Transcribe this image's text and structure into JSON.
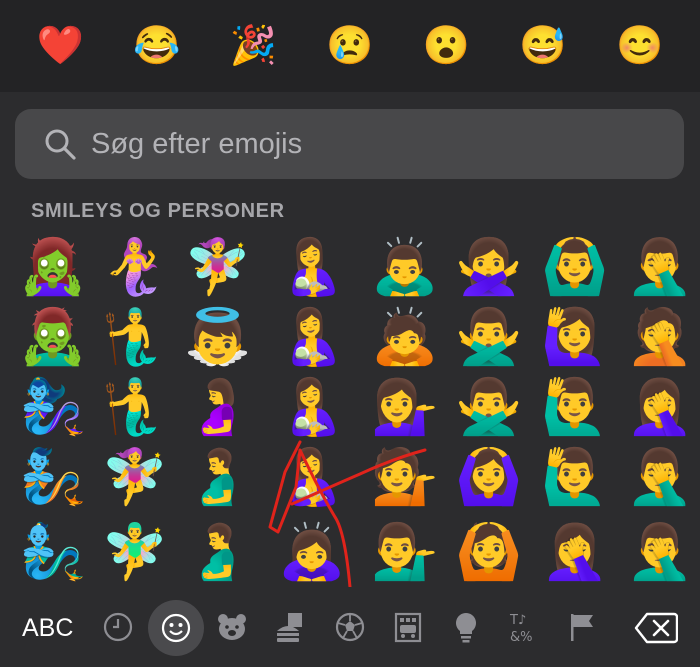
{
  "recents": {
    "emojis": [
      {
        "char": "❤️",
        "icon": "red-heart-icon"
      },
      {
        "char": "😂",
        "icon": "tears-of-joy-icon"
      },
      {
        "char": "🎉",
        "icon": "party-popper-icon"
      },
      {
        "char": "😢",
        "icon": "crying-face-icon"
      },
      {
        "char": "😮",
        "icon": "surprised-face-icon"
      },
      {
        "char": "😅",
        "icon": "sweat-smile-icon"
      },
      {
        "char": "😊",
        "icon": "smiling-face-icon"
      }
    ]
  },
  "search": {
    "placeholder": "Søg efter emojis"
  },
  "section": {
    "title": "SMILEYS OG PERSONER"
  },
  "emoji_grid": {
    "rows": [
      [
        "🧟‍♀️",
        "🧜‍♀️",
        "🧚‍♀️",
        "🤱",
        "🙇‍♂️",
        "🙅‍♀️",
        "🙆‍♂️",
        "🤦‍♂️"
      ],
      [
        "🧟‍♂️",
        "🧜‍♂️",
        "👼",
        "🤱",
        "🙇",
        "🙅‍♂️",
        "🙋‍♀️",
        "🤦"
      ],
      [
        "🧞‍♀️",
        "🧜‍♂️",
        "🤰",
        "🤱",
        "💁‍♀️",
        "🙅‍♂️",
        "🙋‍♂️",
        "🤦‍♀️"
      ],
      [
        "🧞",
        "🧚‍♀️",
        "🫃",
        "🤱",
        "💁",
        "🙆‍♀️",
        "🙋‍♂️",
        "🤦‍♂️"
      ],
      [
        "🧞‍♂️",
        "🧚‍♂️",
        "🫃",
        "🙇‍♀️",
        "💁‍♂️",
        "🙆",
        "🤦‍♀️",
        "🤦‍♂️"
      ]
    ]
  },
  "bottom_bar": {
    "abc_label": "ABC",
    "categories": [
      {
        "icon": "clock-icon",
        "active": false
      },
      {
        "icon": "smiley-icon",
        "active": true
      },
      {
        "icon": "bear-icon",
        "active": false
      },
      {
        "icon": "food-icon",
        "active": false
      },
      {
        "icon": "soccer-ball-icon",
        "active": false
      },
      {
        "icon": "building-icon",
        "active": false
      },
      {
        "icon": "lightbulb-icon",
        "active": false
      },
      {
        "icon": "symbols-icon",
        "active": false
      },
      {
        "icon": "flag-icon",
        "active": false
      }
    ],
    "symbols_label": "T♪ &%",
    "delete_icon": "backspace-icon"
  },
  "colors": {
    "panel_bg": "#2c2c2e",
    "recents_bg": "#232325",
    "search_bg": "#48484a",
    "scribble": "#e0231b"
  }
}
